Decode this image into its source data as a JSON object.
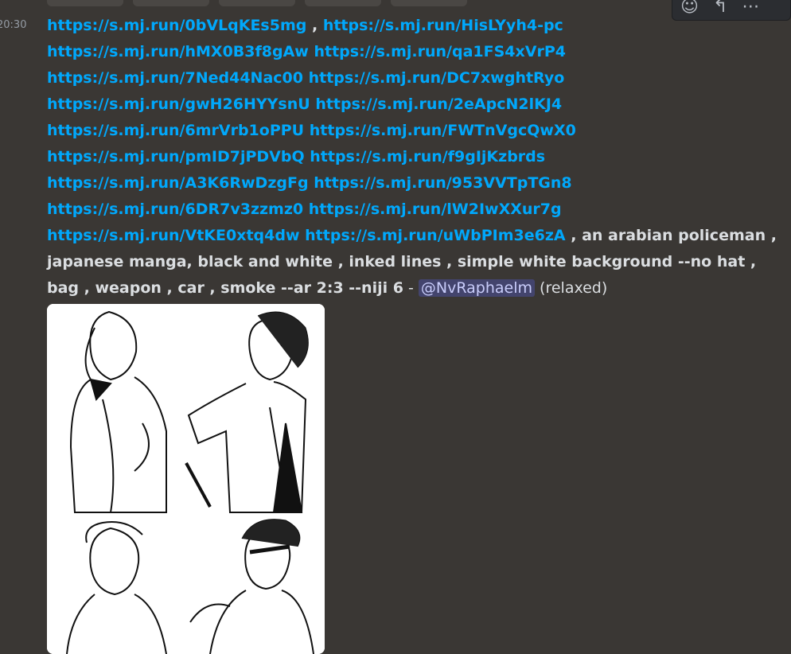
{
  "header": {
    "timestamp": "20:30"
  },
  "toolbar": {
    "icons": [
      "emoji-icon",
      "reply-icon",
      "more-icon"
    ]
  },
  "message": {
    "links": [
      "https://s.mj.run/0bVLqKEs5mg",
      "https://s.mj.run/HisLYyh4-pc",
      "https://s.mj.run/hMX0B3f8gAw",
      "https://s.mj.run/qa1FS4xVrP4",
      "https://s.mj.run/7Ned44Nac00",
      "https://s.mj.run/DC7xwghtRyo",
      "https://s.mj.run/gwH26HYYsnU",
      "https://s.mj.run/2eApcN2lKJ4",
      "https://s.mj.run/6mrVrb1oPPU",
      "https://s.mj.run/FWTnVgcQwX0",
      "https://s.mj.run/pmID7jPDVbQ",
      "https://s.mj.run/f9gIjKzbrds",
      "https://s.mj.run/A3K6RwDzgFg",
      "https://s.mj.run/953VVTpTGn8",
      "https://s.mj.run/6DR7v3zzmz0",
      "https://s.mj.run/lW2IwXXur7g",
      "https://s.mj.run/VtKE0xtq4dw",
      "https://s.mj.run/uWbPIm3e6zA"
    ],
    "comma_sep": " , ",
    "prompt_text": " , an arabian policeman , japanese manga, black and white , inked lines , simple white background --no hat , bag , weapon , car , smoke --ar 2:3 --niji 6",
    "dash": " - ",
    "mention": "@NvRaphaelm",
    "mode": " (relaxed)"
  },
  "attachment": {
    "type": "image",
    "description_icon": "manga-grid-image"
  }
}
